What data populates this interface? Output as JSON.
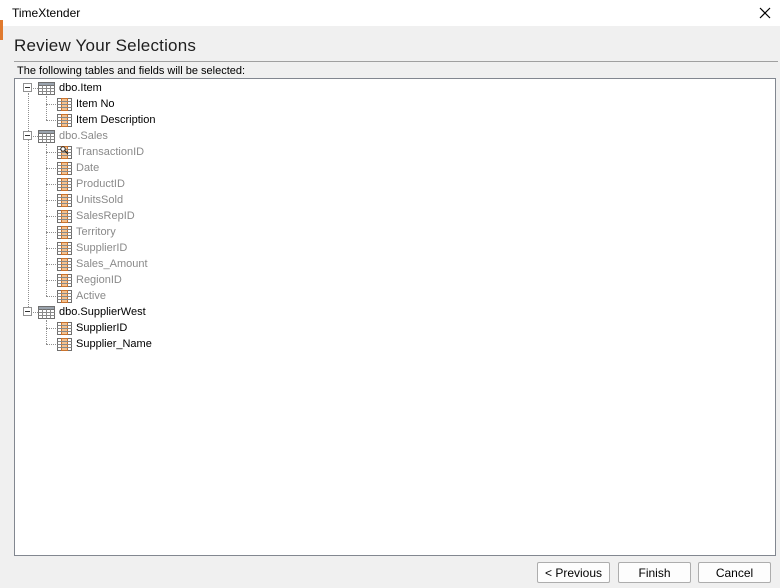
{
  "window": {
    "title": "TimeXtender"
  },
  "page": {
    "heading": "Review Your Selections",
    "subtitle": "The following tables and fields will be selected:"
  },
  "tree": [
    {
      "name": "dbo.Item",
      "dimmed": false,
      "fields": [
        {
          "name": "Item No",
          "dimmed": false
        },
        {
          "name": "Item Description",
          "dimmed": false
        }
      ]
    },
    {
      "name": "dbo.Sales",
      "dimmed": true,
      "fields": [
        {
          "name": "TransactionID",
          "dimmed": true,
          "key": true
        },
        {
          "name": "Date",
          "dimmed": true
        },
        {
          "name": "ProductID",
          "dimmed": true
        },
        {
          "name": "UnitsSold",
          "dimmed": true
        },
        {
          "name": "SalesRepID",
          "dimmed": true
        },
        {
          "name": "Territory",
          "dimmed": true
        },
        {
          "name": "SupplierID",
          "dimmed": true
        },
        {
          "name": "Sales_Amount",
          "dimmed": true
        },
        {
          "name": "RegionID",
          "dimmed": true
        },
        {
          "name": "Active",
          "dimmed": true
        }
      ]
    },
    {
      "name": "dbo.SupplierWest",
      "dimmed": false,
      "fields": [
        {
          "name": "SupplierID",
          "dimmed": false
        },
        {
          "name": "Supplier_Name",
          "dimmed": false
        }
      ]
    }
  ],
  "buttons": {
    "previous": "< Previous",
    "finish": "Finish",
    "cancel": "Cancel"
  },
  "icons": {
    "table": "table-grid-icon",
    "field": "field-column-icon",
    "key": "primary-key-icon",
    "collapse": "collapse-minus-icon",
    "close": "close-icon"
  }
}
